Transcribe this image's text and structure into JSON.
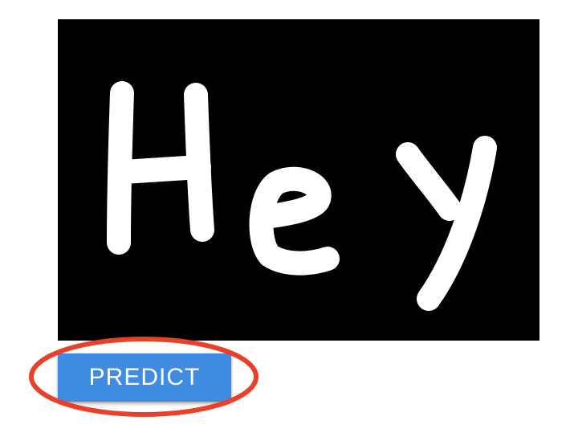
{
  "drawing_canvas": {
    "handwritten_text": "Hey",
    "background_color": "#000000",
    "stroke_color": "#ffffff"
  },
  "predict_button": {
    "label": "PREDICT",
    "color": "#418ce3"
  },
  "annotation": {
    "ring_color": "#e9402a"
  }
}
